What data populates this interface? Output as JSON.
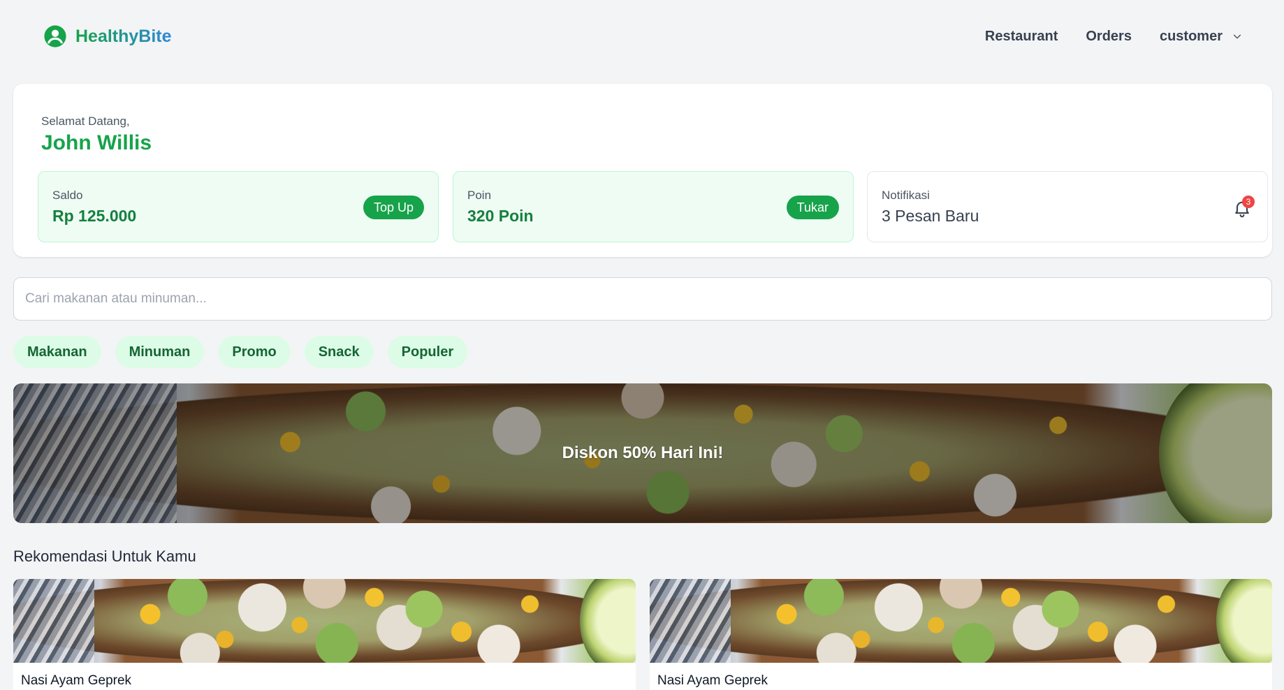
{
  "header": {
    "brand": "HealthyBite",
    "nav": [
      "Restaurant",
      "Orders"
    ],
    "user_menu": "customer",
    "icons": {
      "brand": "user-circle-icon",
      "user_menu": "chevron-down-icon"
    }
  },
  "welcome": {
    "greeting": "Selamat Datang,",
    "name": "John Willis",
    "stats": [
      {
        "label": "Saldo",
        "value": "Rp 125.000",
        "action": "Top Up"
      },
      {
        "label": "Poin",
        "value": "320 Poin",
        "action": "Tukar"
      },
      {
        "label": "Notifikasi",
        "value": "3 Pesan Baru",
        "badge": "3",
        "icon": "bell-icon"
      }
    ]
  },
  "search": {
    "placeholder": "Cari makanan atau minuman...",
    "value": ""
  },
  "categories": [
    "Makanan",
    "Minuman",
    "Promo",
    "Snack",
    "Populer"
  ],
  "banner": {
    "text": "Diskon 50% Hari Ini!"
  },
  "recommendations": {
    "title": "Rekomendasi Untuk Kamu",
    "items": [
      {
        "name": "Nasi Ayam Geprek"
      },
      {
        "name": "Nasi Ayam Geprek"
      }
    ]
  },
  "colors": {
    "primary": "#16a34a",
    "brand_gradient_end": "#2f86d8",
    "badge": "#ef4444",
    "chip_bg": "#dcfce7"
  }
}
